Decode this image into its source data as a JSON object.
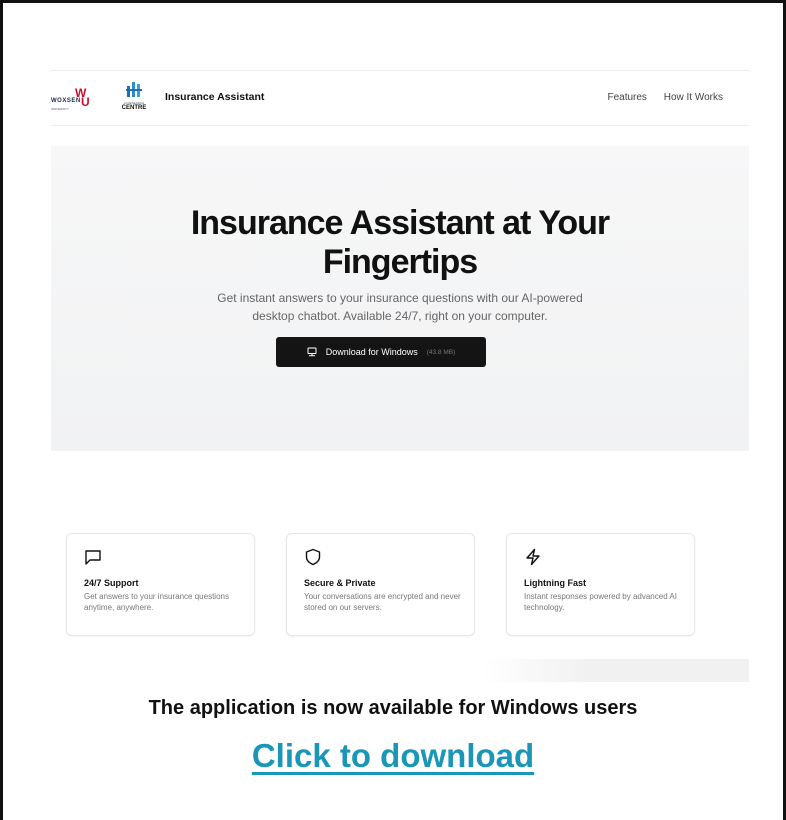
{
  "site": {
    "logos": {
      "woxsen_letter": "W",
      "woxsen_word": "WOXSEN",
      "woxsen_u": "U",
      "woxsen_sub": "UNIVERSITY",
      "centre_sub": "AI RESEARCH",
      "centre_name": "CENTRE"
    },
    "nav": {
      "brand": "Insurance Assistant",
      "links": [
        "Features",
        "How It Works"
      ]
    },
    "hero": {
      "title_line1": "Insurance Assistant at Your",
      "title_line2": "Fingertips",
      "subtitle_line1": "Get instant answers to your insurance questions with our AI-powered",
      "subtitle_line2": "desktop chatbot. Available 24/7, right on your computer.",
      "download_label": "Download for Windows",
      "download_size": "(43.8 MB)"
    },
    "features": [
      {
        "icon": "chat-bubble-icon",
        "title": "24/7 Support",
        "desc": "Get answers to your insurance questions anytime, anywhere."
      },
      {
        "icon": "shield-icon",
        "title": "Secure & Private",
        "desc": "Your conversations are encrypted and never stored on our servers."
      },
      {
        "icon": "lightning-icon",
        "title": "Lightning Fast",
        "desc": "Instant responses powered by advanced AI technology."
      }
    ]
  },
  "caption": "The application is now available for Windows users",
  "cta": "Click to download",
  "colors": {
    "cta": "#1a96b7",
    "button": "#141414",
    "brand_red": "#c8102e"
  }
}
